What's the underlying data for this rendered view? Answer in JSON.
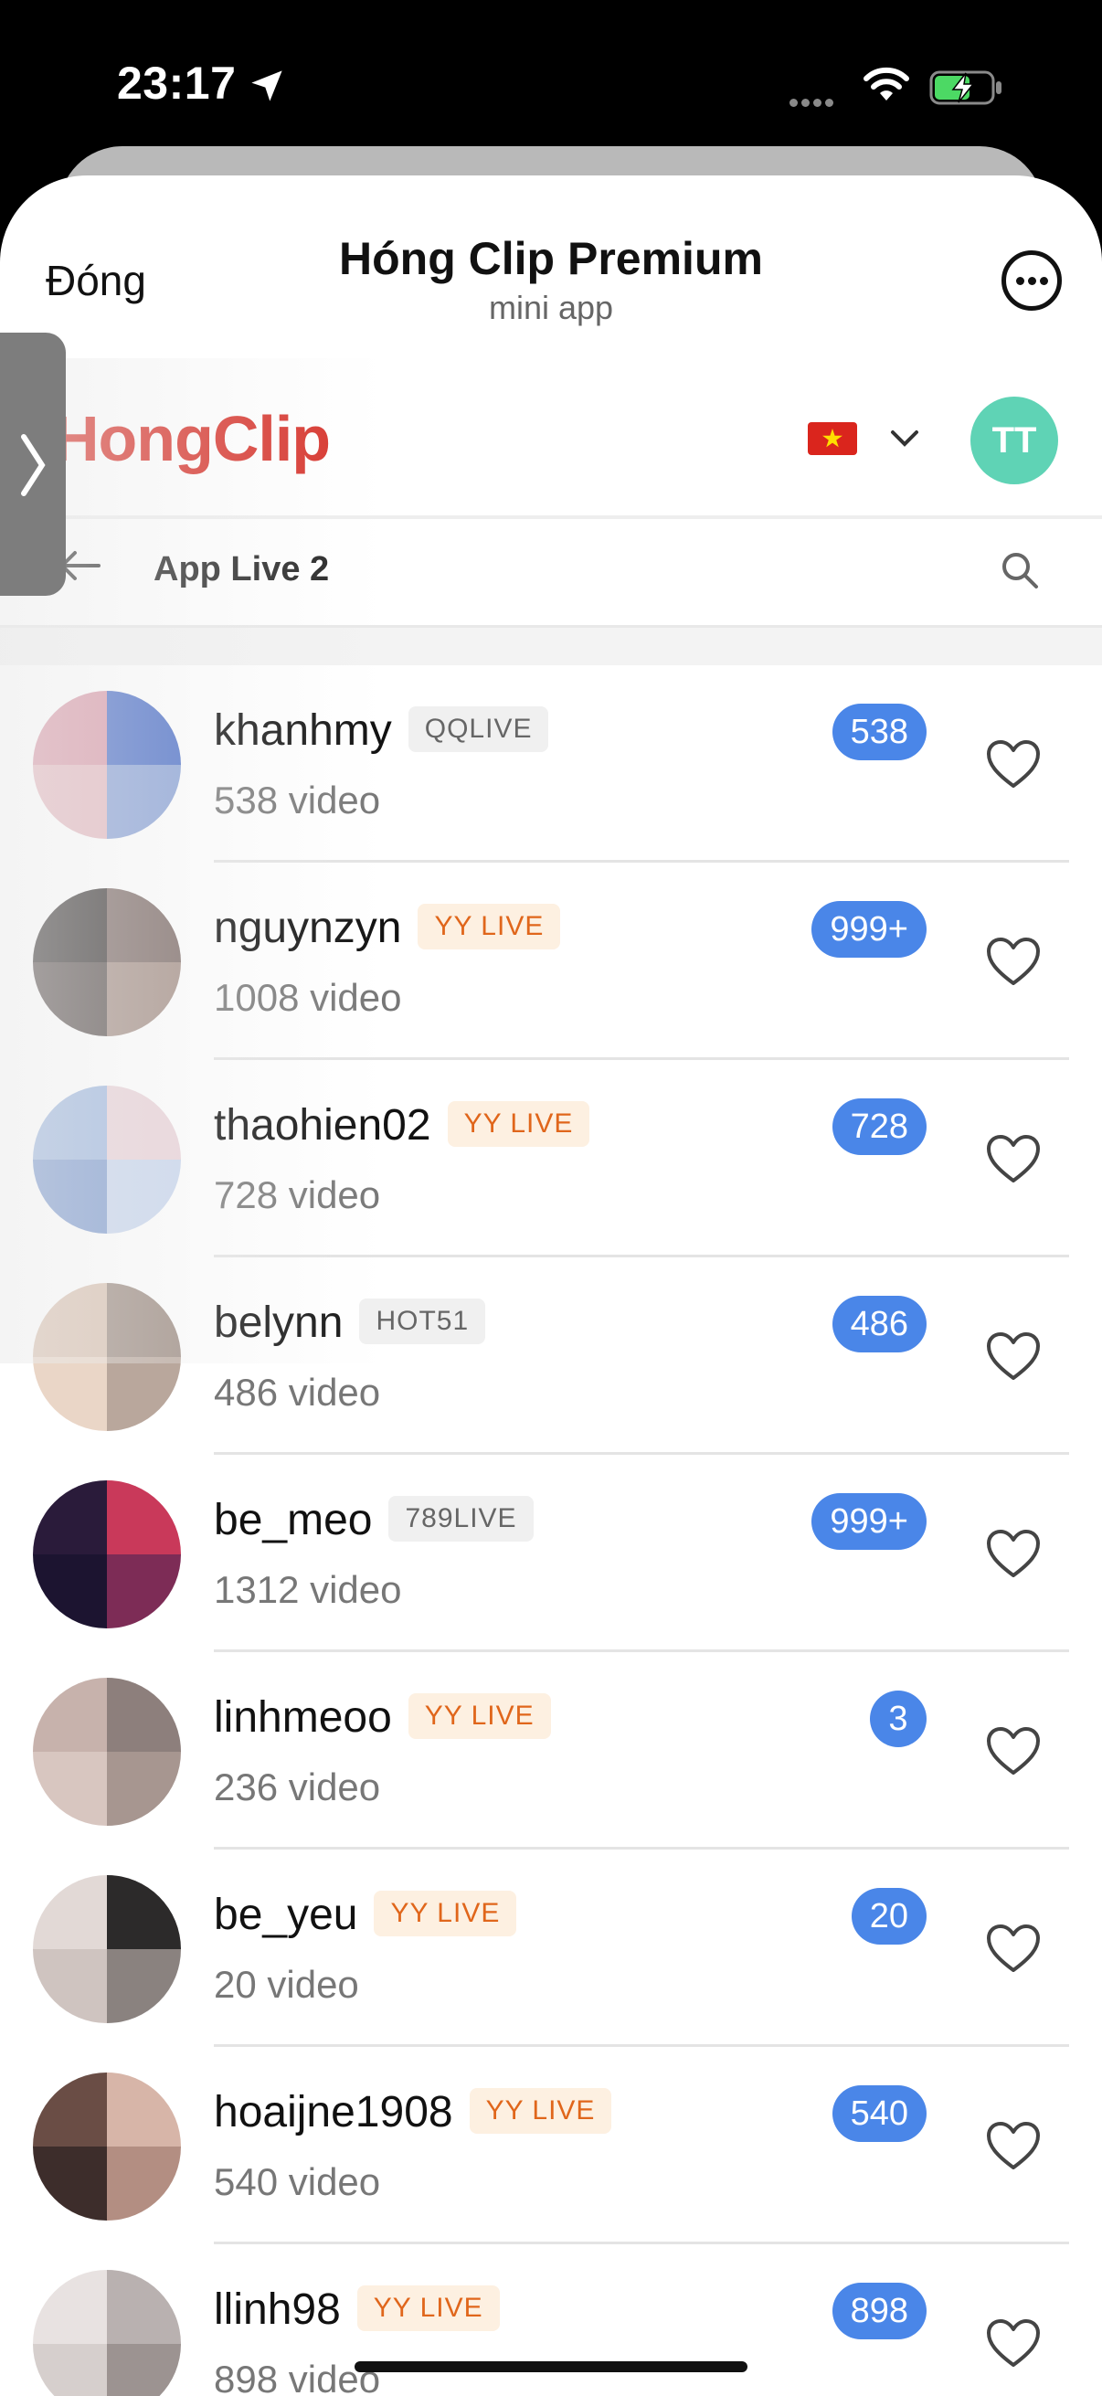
{
  "status": {
    "time": "23:17"
  },
  "mini_app": {
    "close_label": "Đóng",
    "title": "Hóng Clip Premium",
    "subtitle": "mini app"
  },
  "header": {
    "brand": "HongClip",
    "avatar_initials": "TT"
  },
  "page": {
    "title": "App Live 2"
  },
  "colors": {
    "brand": "#d7322a",
    "badge": "#4a86e8",
    "avatar": "#5fd3b5",
    "tag_orange": "#e0661b"
  },
  "streamers": [
    {
      "name": "khanhmy",
      "tag": "QQLIVE",
      "tag_style": "gray",
      "videos": "538 video",
      "badge": "538",
      "thumb": [
        "#d99aa9",
        "#4c6fc7",
        "#e4b9c0",
        "#8aa2d6"
      ]
    },
    {
      "name": "nguynzyn",
      "tag": "YY LIVE",
      "tag_style": "orange",
      "videos": "1008 video",
      "badge": "999+",
      "thumb": [
        "#3b3736",
        "#7c6a66",
        "#5b5250",
        "#a48f86"
      ]
    },
    {
      "name": "thaohien02",
      "tag": "YY LIVE",
      "tag_style": "orange",
      "videos": "728 video",
      "badge": "728",
      "thumb": [
        "#9fb8df",
        "#e9d2d8",
        "#7e9bcf",
        "#c8d6ee"
      ]
    },
    {
      "name": "belynn",
      "tag": "HOT51",
      "tag_style": "gray",
      "videos": "486 video",
      "badge": "486",
      "thumb": [
        "#d9c1b0",
        "#9b8a80",
        "#ead6c7",
        "#b9a79c"
      ]
    },
    {
      "name": "be_meo",
      "tag": "789LIVE",
      "tag_style": "gray",
      "videos": "1312 video",
      "badge": "999+",
      "thumb": [
        "#2a1b3a",
        "#c9395a",
        "#1c1430",
        "#7d2c56"
      ]
    },
    {
      "name": "linhmeoo",
      "tag": "YY LIVE",
      "tag_style": "orange",
      "videos": "236 video",
      "badge": "3",
      "thumb": [
        "#c7b2ac",
        "#8d7f7c",
        "#d8c6c0",
        "#a79690"
      ]
    },
    {
      "name": "be_yeu",
      "tag": "YY LIVE",
      "tag_style": "orange",
      "videos": "20 video",
      "badge": "20",
      "thumb": [
        "#e2d9d6",
        "#2c2a2a",
        "#cfc4c0",
        "#8a827f"
      ]
    },
    {
      "name": "hoaijne1908",
      "tag": "YY LIVE",
      "tag_style": "orange",
      "videos": "540 video",
      "badge": "540",
      "thumb": [
        "#6a4d45",
        "#d7b5a8",
        "#3d2d2b",
        "#b38e82"
      ]
    },
    {
      "name": "llinh98",
      "tag": "YY LIVE",
      "tag_style": "orange",
      "videos": "898 video",
      "badge": "898",
      "thumb": [
        "#e8e2e1",
        "#b9b1b0",
        "#d6cfcd",
        "#9c9391"
      ]
    }
  ]
}
